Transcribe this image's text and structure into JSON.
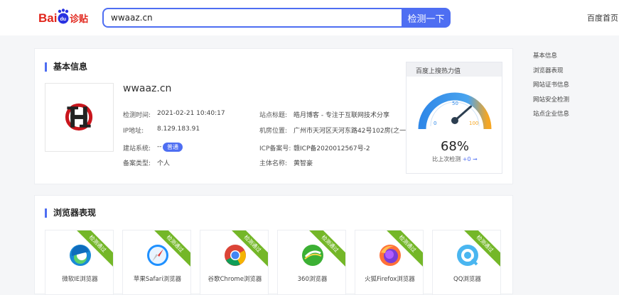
{
  "header": {
    "logo_alt": "Baidu 站长",
    "search_value": "wwaaz.cn",
    "search_button": "检测一下",
    "home_link": "百度首页"
  },
  "basic_info": {
    "title": "基本信息",
    "site_name": "wwaaz.cn",
    "fields": [
      {
        "label": "检测时间:",
        "value": "2021-02-21 10:40:17"
      },
      {
        "label": "IP地址:",
        "value": "8.129.183.91"
      },
      {
        "label": "建站系统:",
        "value": "--"
      },
      {
        "label": "备案类型:",
        "value": "个人"
      },
      {
        "label": "站点标题:",
        "value": "皓月博客 - 专注于互联网技术分享"
      },
      {
        "label": "机房位置:",
        "value": "广州市天河区天河东路42号102房(之一)"
      },
      {
        "label": "ICP备案号:",
        "value": "赣ICP备2020012567号-2"
      },
      {
        "label": "主体名称:",
        "value": "黄智豪"
      }
    ],
    "system_badge": "普通"
  },
  "heat": {
    "title": "百度上搜热力值",
    "tick_0": "0",
    "tick_50": "50",
    "tick_100": "100",
    "value_text": "68%",
    "value": 68,
    "compare_label": "比上次检测",
    "compare_delta": "+0 ➞"
  },
  "side_nav": [
    "基本信息",
    "浏览器表现",
    "网站证书信息",
    "网站安全检测",
    "站点企业信息"
  ],
  "browser_section": {
    "title": "浏览器表现",
    "pass_label": "检测通过",
    "browsers": [
      {
        "name": "微软IE浏览器",
        "icon": "edge-icon"
      },
      {
        "name": "苹果Safari浏览器",
        "icon": "safari-icon"
      },
      {
        "name": "谷歌Chrome浏览器",
        "icon": "chrome-icon"
      },
      {
        "name": "360浏览器",
        "icon": "360-browser-icon"
      },
      {
        "name": "火狐Firefox浏览器",
        "icon": "firefox-icon"
      },
      {
        "name": "QQ浏览器",
        "icon": "qq-browser-icon"
      }
    ]
  },
  "colors": {
    "brand_blue": "#4e6ef2",
    "pass_green": "#74b728",
    "gauge_blue": "#2f88e8",
    "gauge_orange": "#f5a623"
  }
}
